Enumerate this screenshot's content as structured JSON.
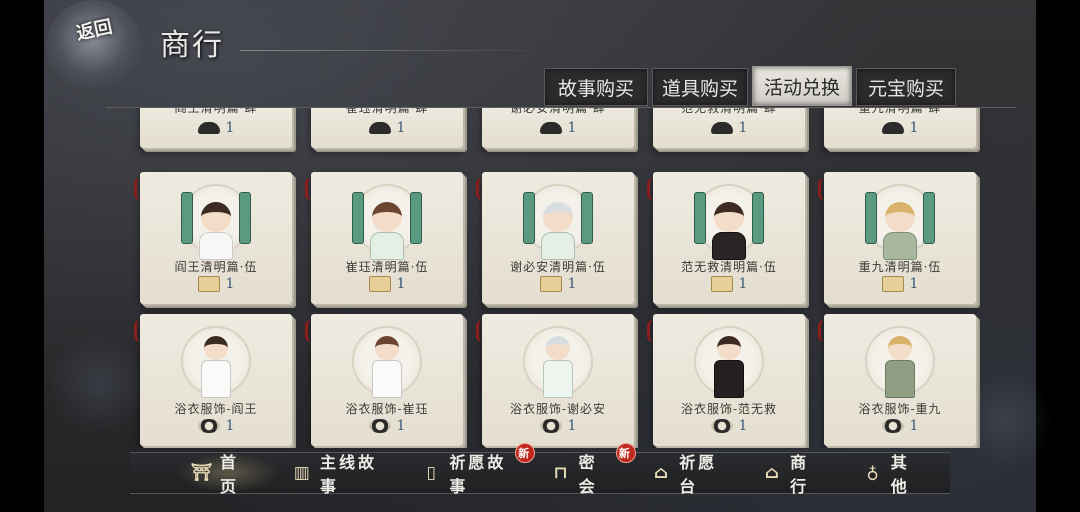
{
  "header": {
    "back_label": "返回",
    "page_title": "商行"
  },
  "tabs": [
    {
      "label": "故事购买",
      "active": false
    },
    {
      "label": "道具购买",
      "active": false
    },
    {
      "label": "活动兑换",
      "active": true
    },
    {
      "label": "元宝购买",
      "active": false
    }
  ],
  "rows": [
    {
      "items": [
        {
          "name": "阎王清明篇·肆",
          "cost_icon": "lamp-icon",
          "price": "1"
        },
        {
          "name": "崔珏清明篇·肆",
          "cost_icon": "lamp-icon",
          "price": "1"
        },
        {
          "name": "谢必安清明篇·肆",
          "cost_icon": "lamp-icon",
          "price": "1"
        },
        {
          "name": "范无救清明篇·肆",
          "cost_icon": "lamp-icon",
          "price": "1"
        },
        {
          "name": "重九清明篇·肆",
          "cost_icon": "lamp-icon",
          "price": "1"
        }
      ]
    },
    {
      "items": [
        {
          "name": "阎王清明篇·伍",
          "cost_icon": "scroll-icon",
          "price": "1"
        },
        {
          "name": "崔珏清明篇·伍",
          "cost_icon": "scroll-icon",
          "price": "1"
        },
        {
          "name": "谢必安清明篇·伍",
          "cost_icon": "scroll-icon",
          "price": "1"
        },
        {
          "name": "范无救清明篇·伍",
          "cost_icon": "scroll-icon",
          "price": "1"
        },
        {
          "name": "重九清明篇·伍",
          "cost_icon": "scroll-icon",
          "price": "1"
        }
      ]
    },
    {
      "items": [
        {
          "name": "浴衣服饰-阎王",
          "cost_icon": "coin-icon",
          "price": "1"
        },
        {
          "name": "浴衣服饰-崔珏",
          "cost_icon": "coin-icon",
          "price": "1"
        },
        {
          "name": "浴衣服饰-谢必安",
          "cost_icon": "coin-icon",
          "price": "1"
        },
        {
          "name": "浴衣服饰-范无救",
          "cost_icon": "coin-icon",
          "price": "1"
        },
        {
          "name": "浴衣服饰-重九",
          "cost_icon": "coin-icon",
          "price": "1"
        }
      ]
    }
  ],
  "bottom_nav": [
    {
      "label": "首 页",
      "icon": "home-icon",
      "active": true,
      "badge": ""
    },
    {
      "label": "主线故事",
      "icon": "book-icon",
      "active": false,
      "badge": ""
    },
    {
      "label": "祈愿故事",
      "icon": "charm-icon",
      "active": false,
      "badge": "新"
    },
    {
      "label": "密 会",
      "icon": "gate-icon",
      "active": false,
      "badge": "新"
    },
    {
      "label": "祈愿台",
      "icon": "shrine-icon",
      "active": false,
      "badge": ""
    },
    {
      "label": "商 行",
      "icon": "shop-icon",
      "active": false,
      "badge": ""
    },
    {
      "label": "其 他",
      "icon": "pouch-icon",
      "active": false,
      "badge": ""
    }
  ]
}
